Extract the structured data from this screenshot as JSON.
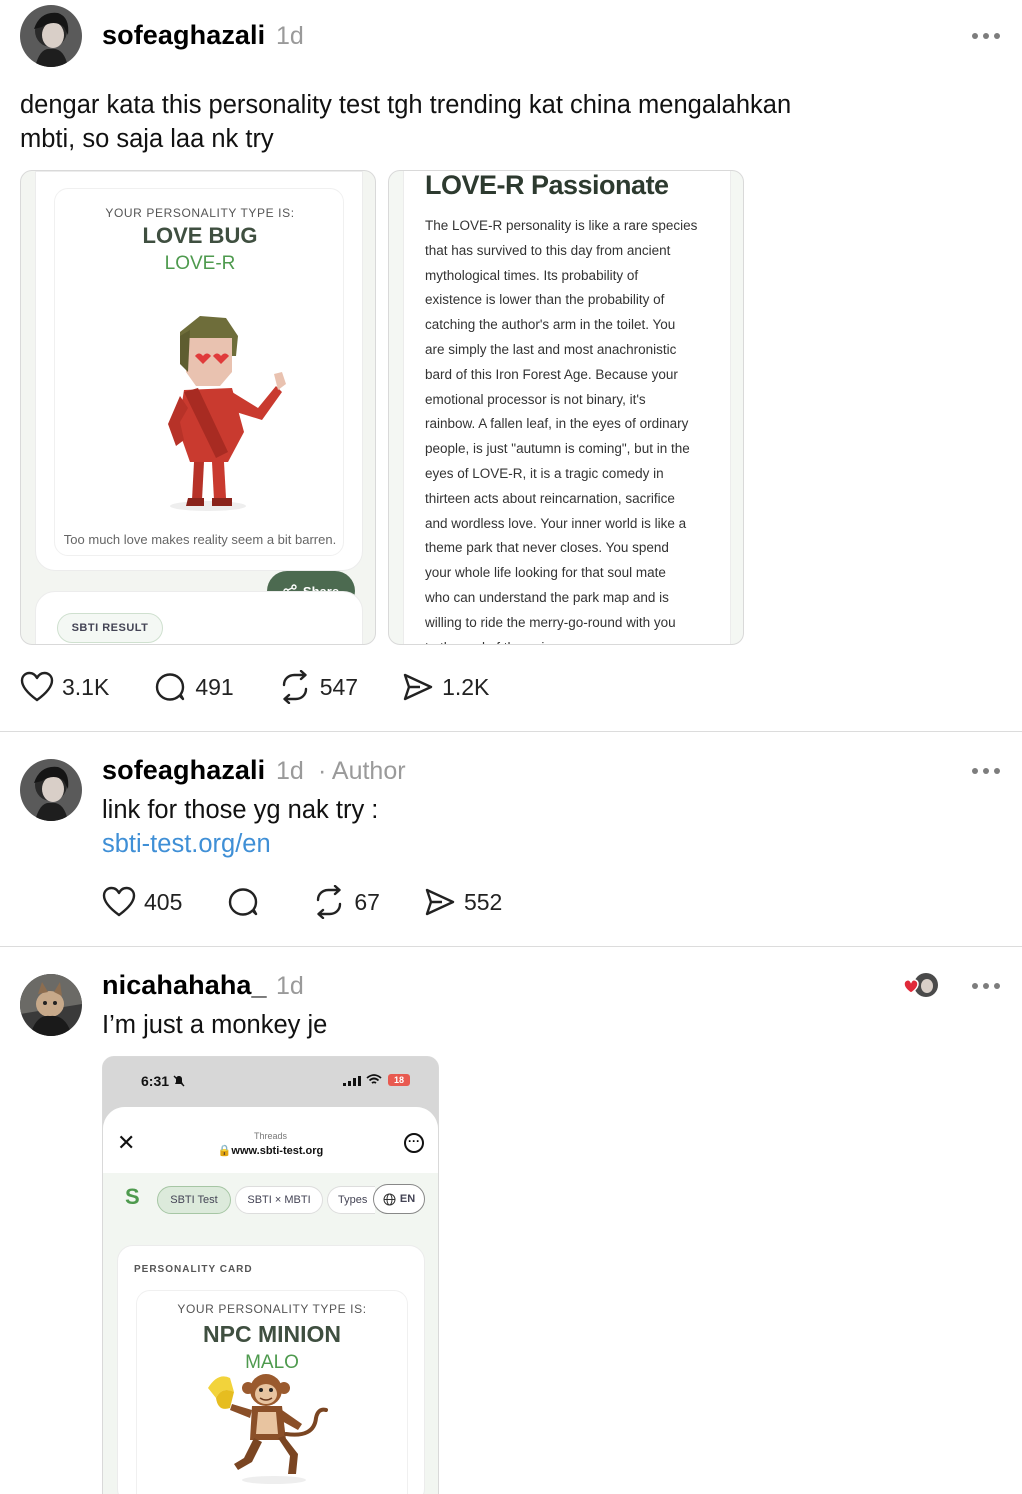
{
  "posts": [
    {
      "username": "sofeaghazali",
      "time": "1d",
      "text_line1": "dengar kata this personality test tgh trending kat china mengalahkan",
      "text_line2": "mbti, so saja laa nk try",
      "image1": {
        "heading": "YOUR PERSONALITY TYPE IS:",
        "type_name": "LOVE BUG",
        "type_code": "LOVE-R",
        "caption": "Too much love makes reality seem a bit barren.",
        "share_label": "Share",
        "result_pill": "SBTI RESULT"
      },
      "image2": {
        "title": "LOVE-R Passionate",
        "lines": [
          "The LOVE-R personality is like a rare species",
          "that has survived to this day from ancient",
          "mythological times. Its probability of",
          "existence is lower than the probability of",
          "catching the author's arm in the toilet. You",
          "are simply the last and most anachronistic",
          "bard of this Iron Forest Age. Because your",
          "emotional processor is not binary, it's",
          "rainbow. A fallen leaf, in the eyes of ordinary",
          "people, is just \"autumn is coming\", but in the",
          "eyes of LOVE-R, it is a tragic comedy in",
          "thirteen acts about reincarnation, sacrifice",
          "and wordless love. Your inner world is like a",
          "theme park that never closes. You spend",
          "your whole life looking for that soul mate",
          "who can understand the park map and is",
          "willing to ride the merry-go-round with you",
          "to the end of the universe."
        ]
      },
      "likes": "3.1K",
      "replies": "491",
      "reposts": "547",
      "shares": "1.2K"
    },
    {
      "username": "sofeaghazali",
      "time": "1d",
      "author_badge": "· Author",
      "text": "link for those yg nak try :",
      "link": "sbti-test.org/en",
      "likes": "405",
      "replies": "",
      "reposts": "67",
      "shares": "552"
    },
    {
      "username": "nicahahaha_",
      "time": "1d",
      "text": "I’m just a monkey je",
      "screenshot": {
        "clock": "6:31",
        "battery": "18",
        "site_label": "Threads",
        "url": "www.sbti-test.org",
        "logo": "S",
        "tabs": [
          "SBTI Test",
          "SBTI × MBTI",
          "Types"
        ],
        "lang": "EN",
        "card_label": "PERSONALITY CARD",
        "heading": "YOUR PERSONALITY TYPE IS:",
        "type_name": "NPC MINION",
        "type_code": "MALO"
      }
    }
  ],
  "colors": {
    "link": "#3f8fd6",
    "muted": "#9a9a9a",
    "green_dark": "#4c6a50",
    "green_text": "#4e9a4e"
  }
}
